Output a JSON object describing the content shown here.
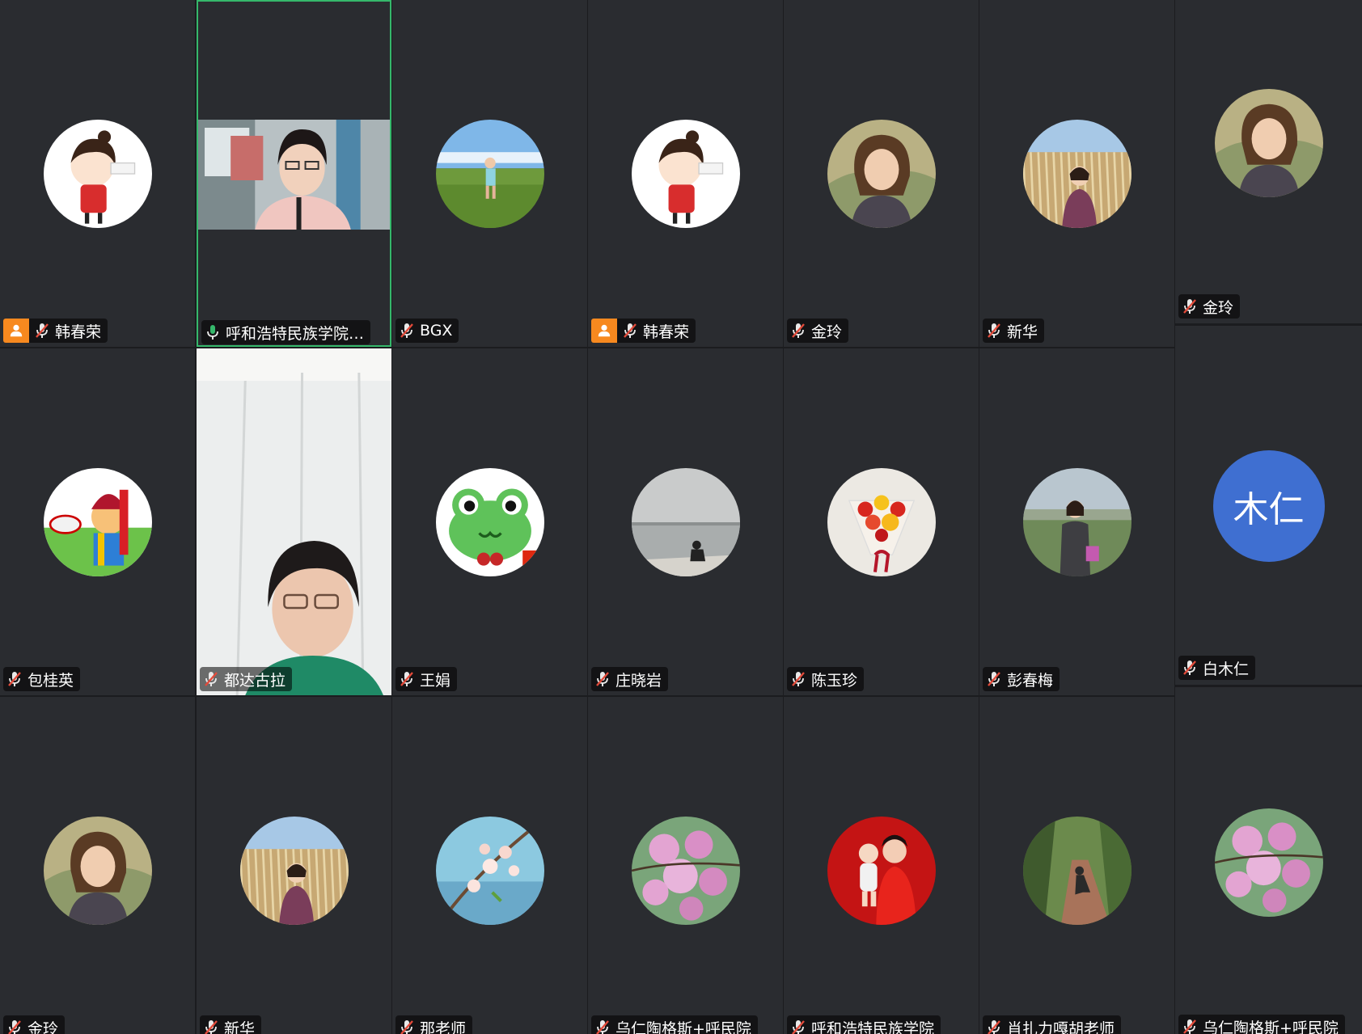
{
  "colors": {
    "tile_background": "#2a2c30",
    "active_speaker_border": "#35b86b",
    "host_badge": "#f7891f",
    "muted_icon": "#e34b3b",
    "initials_avatar": "#3f6fd1"
  },
  "participants": [
    {
      "name": "韩春荣",
      "host": true,
      "muted": true,
      "avatar": "cartoon-girl"
    },
    {
      "name": "呼和浩特民族学院…",
      "host": false,
      "muted": false,
      "video": "woman-with-glasses",
      "active": true
    },
    {
      "name": "BGX",
      "host": false,
      "muted": true,
      "avatar": "child-in-grassland"
    },
    {
      "name": "韩春荣",
      "host": true,
      "muted": true,
      "avatar": "cartoon-girl"
    },
    {
      "name": "金玲",
      "host": false,
      "muted": true,
      "avatar": "painted-girl"
    },
    {
      "name": "新华",
      "host": false,
      "muted": true,
      "avatar": "woman-in-reeds"
    },
    {
      "name": "金玲",
      "host": false,
      "muted": true,
      "avatar": "painted-girl"
    },
    {
      "name": "包桂英",
      "host": false,
      "muted": true,
      "avatar": "mongolian-cartoon"
    },
    {
      "name": "都达古拉",
      "host": false,
      "muted": true,
      "video": "woman-at-wall"
    },
    {
      "name": "王娟",
      "host": false,
      "muted": true,
      "avatar": "green-frog"
    },
    {
      "name": "庄晓岩",
      "host": false,
      "muted": true,
      "avatar": "person-by-lake"
    },
    {
      "name": "陈玉珍",
      "host": false,
      "muted": true,
      "avatar": "flower-bouquet"
    },
    {
      "name": "彭春梅",
      "host": false,
      "muted": true,
      "avatar": "woman-in-park"
    },
    {
      "name": "白木仁",
      "host": false,
      "muted": true,
      "initials": "木仁"
    },
    {
      "name": "金玲",
      "host": false,
      "muted": true,
      "avatar": "painted-girl"
    },
    {
      "name": "新华",
      "host": false,
      "muted": true,
      "avatar": "woman-in-reeds"
    },
    {
      "name": "那老师",
      "host": false,
      "muted": true,
      "avatar": "blossom-sky"
    },
    {
      "name": "乌仁陶格斯+呼民院",
      "host": false,
      "muted": true,
      "avatar": "pink-flowers"
    },
    {
      "name": "呼和浩特民族学院",
      "host": false,
      "muted": true,
      "avatar": "red-mother-baby"
    },
    {
      "name": "肖扎力嘎胡老师",
      "host": false,
      "muted": true,
      "avatar": "woman-on-path"
    },
    {
      "name": "乌仁陶格斯+呼民院",
      "host": false,
      "muted": true,
      "avatar": "pink-flowers"
    }
  ]
}
